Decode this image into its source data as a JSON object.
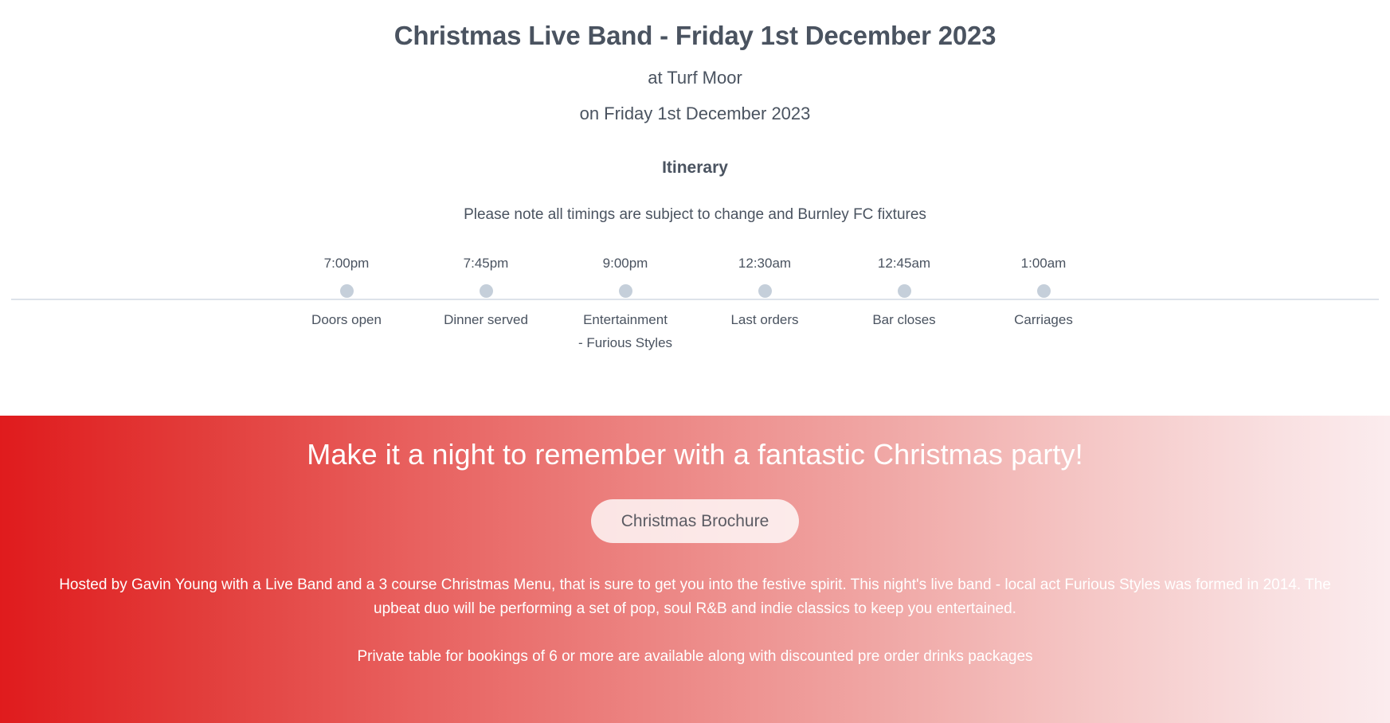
{
  "event": {
    "title": "Christmas Live Band - Friday 1st December 2023",
    "venue": "at Turf Moor",
    "date": "on Friday 1st December 2023"
  },
  "itinerary": {
    "heading": "Itinerary",
    "note": "Please note all timings are subject to change and Burnley FC fixtures",
    "entries": [
      {
        "time": "7:00pm",
        "label": "Doors open"
      },
      {
        "time": "7:45pm",
        "label": "Dinner served"
      },
      {
        "time": "9:00pm",
        "label": "Entertainment\n- Furious Styles"
      },
      {
        "time": "12:30am",
        "label": "Last orders"
      },
      {
        "time": "12:45am",
        "label": "Bar closes"
      },
      {
        "time": "1:00am",
        "label": "Carriages"
      }
    ]
  },
  "banner": {
    "headline": "Make it a night to remember with a fantastic Christmas party!",
    "brochure_button": "Christmas Brochure",
    "paragraph_1": "Hosted by Gavin Young with a Live Band and a 3 course Christmas Menu, that is sure to get you into the festive spirit. This night's live band - local act Furious Styles was formed in 2014. The upbeat duo will be performing a set of pop, soul R&B and indie classics to keep you entertained.",
    "paragraph_2": "Private table for bookings of 6 or more are available along with discounted pre order drinks packages"
  },
  "colors": {
    "text_dark": "#4a5360",
    "gradient_start": "#e01b1d",
    "gradient_end": "#fbecee",
    "timeline_dot": "#c5cfda",
    "timeline_rail": "#dde3ea",
    "button_text": "#5b5b63"
  }
}
